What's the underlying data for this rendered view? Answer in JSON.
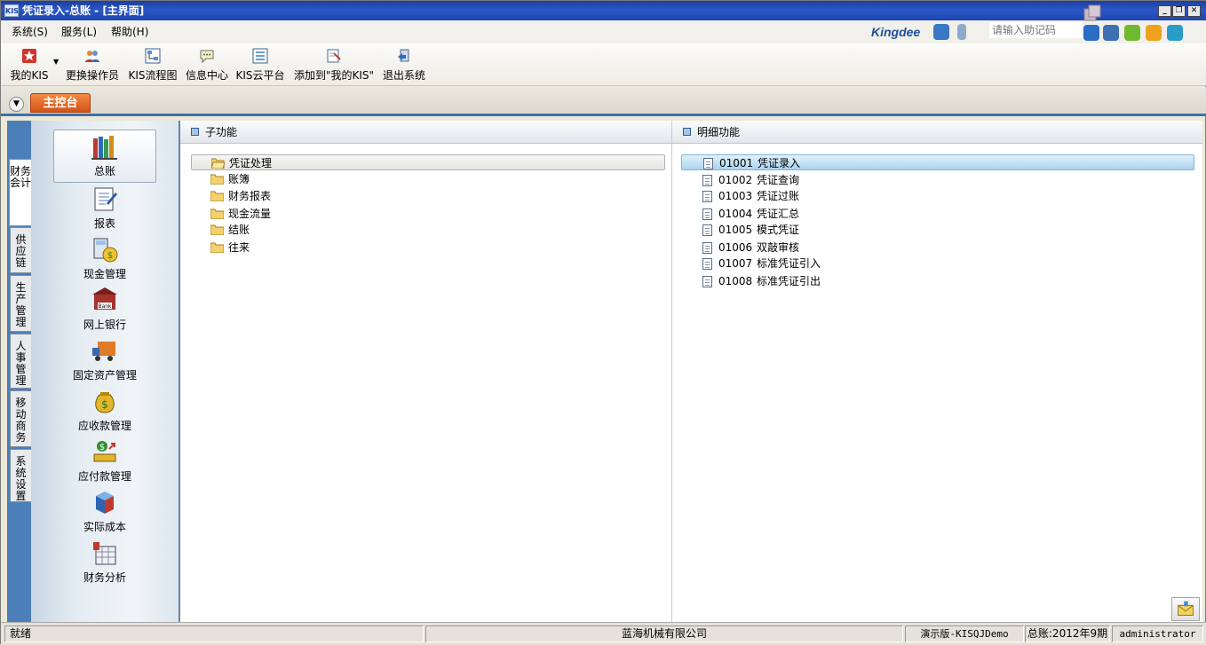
{
  "window": {
    "title": "凭证录入-总账 - [主界面]",
    "logo_text": "KIS"
  },
  "menu": [
    "系统(S)",
    "服务(L)",
    "帮助(H)"
  ],
  "brand": "Kingdee",
  "help_code_placeholder": "请输入助记码",
  "toolbar": [
    {
      "label": "我的KIS",
      "icon": "star-icon"
    },
    {
      "label": "更换操作员",
      "icon": "users-icon"
    },
    {
      "label": "KIS流程图",
      "icon": "flowchart-icon"
    },
    {
      "label": "信息中心",
      "icon": "chat-bubble-icon"
    },
    {
      "label": "KIS云平台",
      "icon": "grid-icon"
    },
    {
      "label": "添加到\"我的KIS\"",
      "icon": "add-page-icon"
    },
    {
      "label": "退出系统",
      "icon": "exit-icon"
    }
  ],
  "main_tab": "主控台",
  "vertical_tabs": [
    "财务会计",
    "供应链",
    "生产管理",
    "人事管理",
    "移动商务",
    "系统设置"
  ],
  "modules": [
    "总账",
    "报表",
    "现金管理",
    "网上银行",
    "固定资产管理",
    "应收款管理",
    "应付款管理",
    "实际成本",
    "财务分析"
  ],
  "sub_panel": {
    "title": "子功能",
    "items": [
      "凭证处理",
      "账簿",
      "财务报表",
      "现金流量",
      "结账",
      "往来"
    ]
  },
  "detail_panel": {
    "title": "明细功能",
    "items": [
      {
        "code": "01001",
        "name": "凭证录入"
      },
      {
        "code": "01002",
        "name": "凭证查询"
      },
      {
        "code": "01003",
        "name": "凭证过账"
      },
      {
        "code": "01004",
        "name": "凭证汇总"
      },
      {
        "code": "01005",
        "name": "模式凭证"
      },
      {
        "code": "01006",
        "name": "双敲审核"
      },
      {
        "code": "01007",
        "name": "标准凭证引入"
      },
      {
        "code": "01008",
        "name": "标准凭证引出"
      }
    ]
  },
  "status": {
    "state": "就绪",
    "company": "蓝海机械有限公司",
    "version": "演示版-KISQJDemo",
    "period": "总账:2012年9期",
    "user": "administrator"
  }
}
